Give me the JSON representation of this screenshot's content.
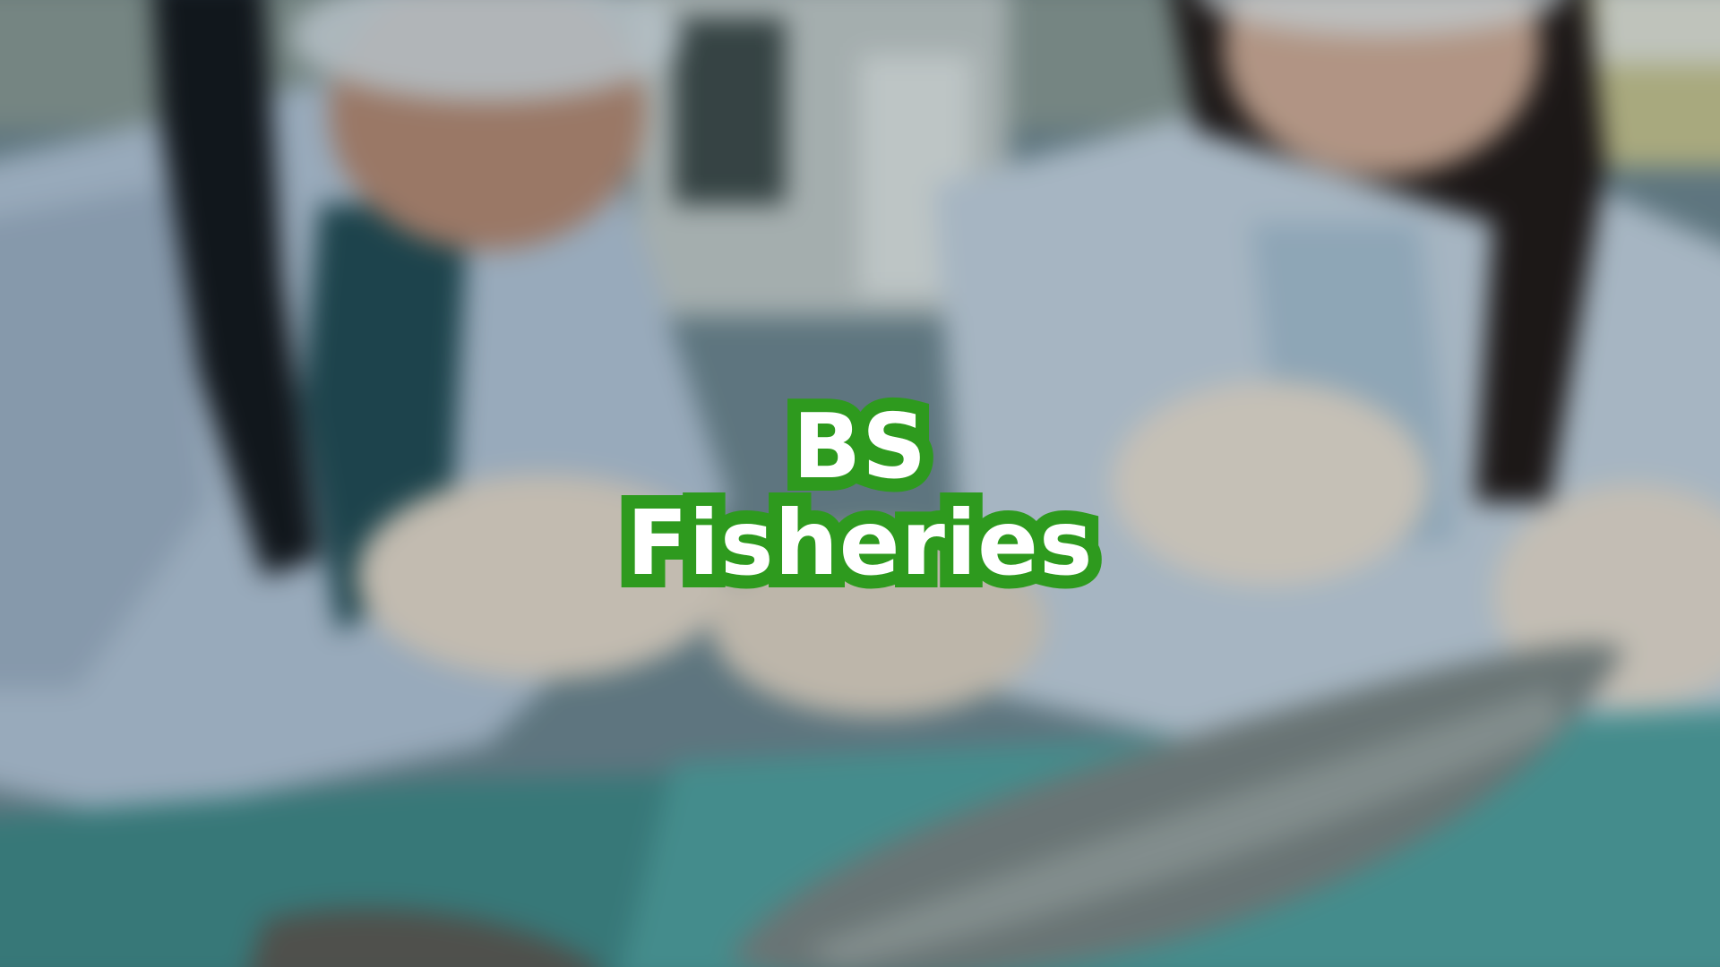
{
  "title": {
    "line1": "BS",
    "line2": "Fisheries"
  },
  "colors": {
    "title_text": "#ffffff",
    "title_outline": "#2e9a1e"
  },
  "background": {
    "description_icon": "blurred-lab-photo-image"
  }
}
